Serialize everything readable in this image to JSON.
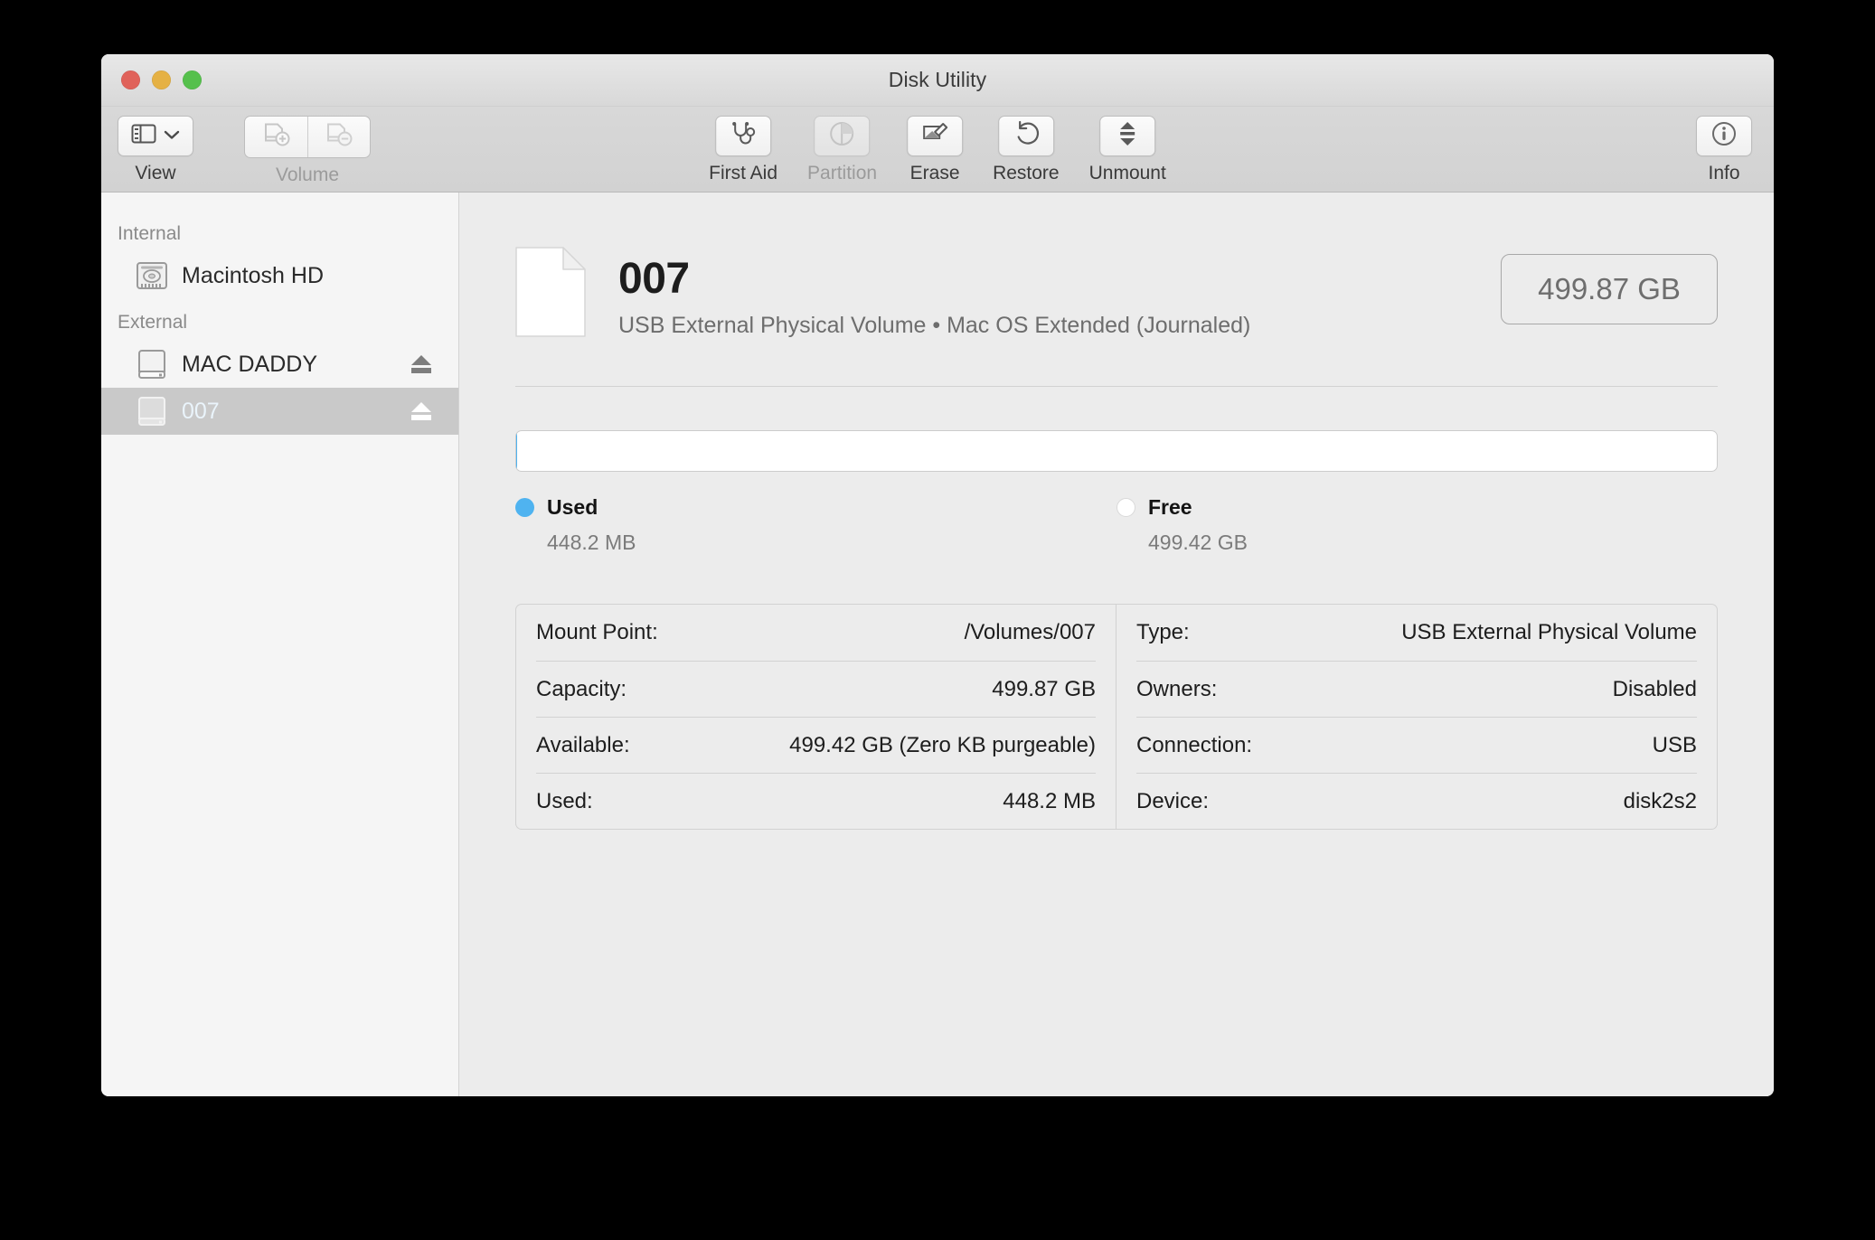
{
  "window": {
    "title": "Disk Utility",
    "traffic_lights": [
      "close",
      "minimize",
      "maximize"
    ]
  },
  "toolbar": {
    "view": {
      "label": "View",
      "icon": "sidebar-icon",
      "chevron": "chevron-down-icon",
      "enabled": true
    },
    "volume": {
      "label": "Volume",
      "add_icon": "volume-add-icon",
      "remove_icon": "volume-remove-icon",
      "enabled": false
    },
    "actions": [
      {
        "label": "First Aid",
        "icon": "stethoscope-icon",
        "enabled": true
      },
      {
        "label": "Partition",
        "icon": "pie-chart-icon",
        "enabled": false
      },
      {
        "label": "Erase",
        "icon": "erase-pencil-icon",
        "enabled": true
      },
      {
        "label": "Restore",
        "icon": "undo-arrow-icon",
        "enabled": true
      },
      {
        "label": "Unmount",
        "icon": "eject-updown-icon",
        "enabled": true
      }
    ],
    "info": {
      "label": "Info",
      "icon": "info-circle-icon",
      "enabled": true
    }
  },
  "sidebar": {
    "groups": [
      {
        "header": "Internal",
        "items": [
          {
            "label": "Macintosh HD",
            "icon": "internal-drive-icon",
            "selected": false,
            "ejectable": false
          }
        ]
      },
      {
        "header": "External",
        "items": [
          {
            "label": "MAC DADDY",
            "icon": "external-drive-icon",
            "selected": false,
            "ejectable": true
          },
          {
            "label": "007",
            "icon": "external-drive-icon",
            "selected": true,
            "ejectable": true
          }
        ]
      }
    ]
  },
  "volume": {
    "icon": "document-volume-icon",
    "name": "007",
    "subtitle": "USB External Physical Volume • Mac OS Extended (Journaled)",
    "capacity_badge": "499.87 GB"
  },
  "usage": {
    "used_percent": 0.09,
    "free_percent": 99.91,
    "legend": [
      {
        "name": "Used",
        "value": "448.2 MB",
        "color": "#4fb3f0"
      },
      {
        "name": "Free",
        "value": "499.42 GB",
        "color": "#ffffff"
      }
    ]
  },
  "info": {
    "left": [
      {
        "label": "Mount Point:",
        "value": "/Volumes/007"
      },
      {
        "label": "Capacity:",
        "value": "499.87 GB"
      },
      {
        "label": "Available:",
        "value": "499.42 GB (Zero KB purgeable)"
      },
      {
        "label": "Used:",
        "value": "448.2 MB"
      }
    ],
    "right": [
      {
        "label": "Type:",
        "value": "USB External Physical Volume"
      },
      {
        "label": "Owners:",
        "value": "Disabled"
      },
      {
        "label": "Connection:",
        "value": "USB"
      },
      {
        "label": "Device:",
        "value": "disk2s2"
      }
    ]
  },
  "colors": {
    "accent_used": "#4fb3f0",
    "selection": "#c9c9c9",
    "window_bg": "#ececec",
    "sidebar_bg": "#f5f5f5"
  }
}
